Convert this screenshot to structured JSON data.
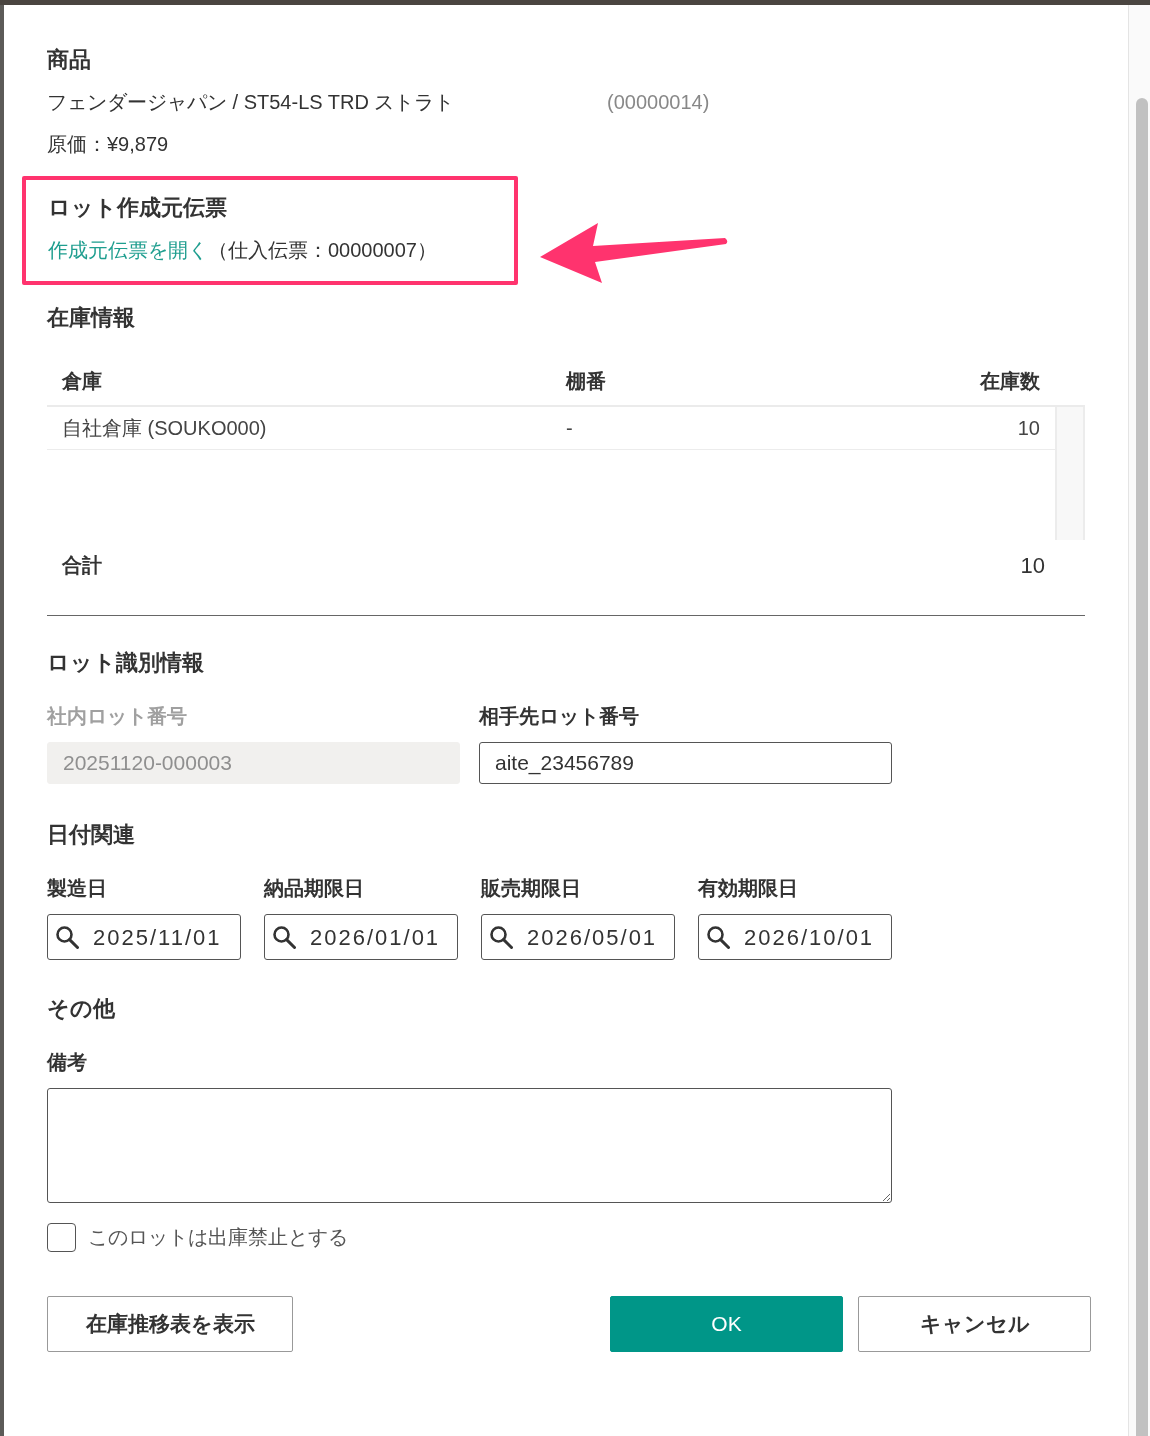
{
  "product": {
    "heading": "商品",
    "name": "フェンダージャパン / ST54-LS TRD ストラト",
    "code": "(00000014)",
    "cost": "原価：¥9,879"
  },
  "source_slip": {
    "heading": "ロット作成元伝票",
    "link": "作成元伝票を開く",
    "detail": "（仕入伝票：00000007）",
    "highlighted": true
  },
  "stock": {
    "heading": "在庫情報",
    "columns": [
      "倉庫",
      "棚番",
      "在庫数"
    ],
    "rows": [
      [
        "自社倉庫 (SOUKO000)",
        "-",
        "10"
      ]
    ],
    "total_label": "合計",
    "total": "10"
  },
  "lot_id": {
    "heading": "ロット識別情報",
    "fields": [
      {
        "label": "社内ロット番号",
        "value": "20251120-000003",
        "disabled": true
      },
      {
        "label": "相手先ロット番号",
        "value": "aite_23456789",
        "disabled": false
      }
    ]
  },
  "dates": {
    "heading": "日付関連",
    "fields": [
      {
        "label": "製造日",
        "value": "2025/11/01"
      },
      {
        "label": "納品期限日",
        "value": "2026/01/01"
      },
      {
        "label": "販売期限日",
        "value": "2026/05/01"
      },
      {
        "label": "有効期限日",
        "value": "2026/10/01"
      }
    ]
  },
  "other": {
    "heading": "その他",
    "remarks_label": "備考",
    "checkbox": {
      "label": "このロットは出庫禁止とする",
      "checked": false
    }
  },
  "buttons": [
    {
      "label": "在庫推移表を表示",
      "kind": "secondary"
    },
    {
      "label": "OK",
      "kind": "primary"
    },
    {
      "label": "キャンセル",
      "kind": "secondary"
    }
  ]
}
